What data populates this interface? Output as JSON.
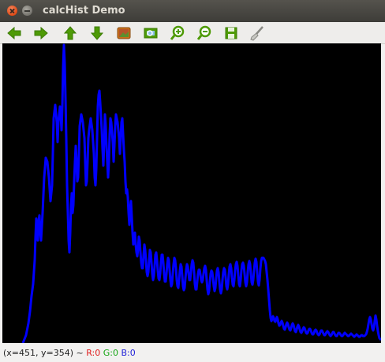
{
  "window": {
    "title": "calcHist Demo"
  },
  "toolbar": {
    "icons": [
      "arrow-left-icon",
      "arrow-right-icon",
      "arrow-up-icon",
      "arrow-down-icon",
      "image-icon",
      "zoom-fit-icon",
      "zoom-in-icon",
      "zoom-out-icon",
      "save-icon",
      "brush-icon"
    ]
  },
  "histogram": {
    "line_color": "#0000ff",
    "background": "#000000"
  },
  "status": {
    "coords": "(x=451, y=354)",
    "separator": "~",
    "r": "R:0",
    "g": "G:0",
    "b": "B:0"
  },
  "colors": {
    "toolbar_green": "#4e9a06",
    "close_button": "#e95420"
  }
}
